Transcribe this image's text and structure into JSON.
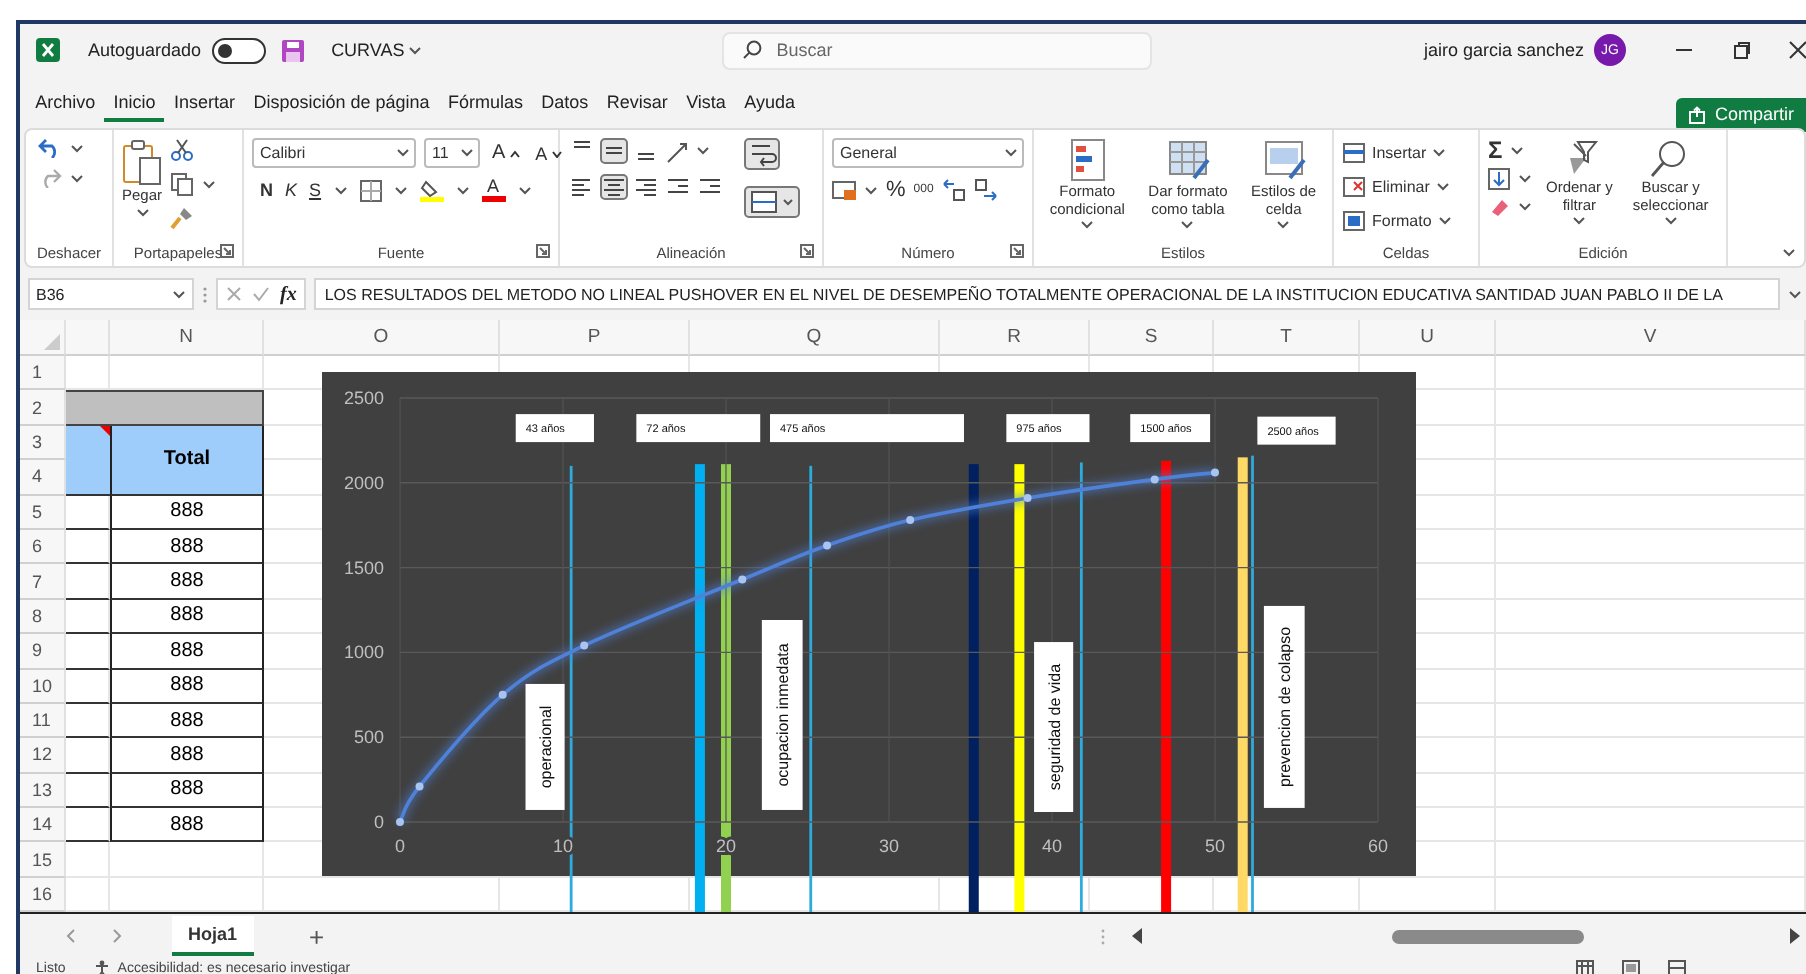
{
  "titlebar": {
    "autosave_label": "Autoguardado",
    "autosave_on": false,
    "file_name": "CURVAS",
    "search_placeholder": "Buscar",
    "user_name": "jairo garcia sanchez",
    "user_initials": "JG"
  },
  "menu": {
    "tabs": [
      {
        "label": "Archivo",
        "selected": false
      },
      {
        "label": "Inicio",
        "selected": true
      },
      {
        "label": "Insertar",
        "selected": false
      },
      {
        "label": "Disposición de página",
        "selected": false
      },
      {
        "label": "Fórmulas",
        "selected": false
      },
      {
        "label": "Datos",
        "selected": false
      },
      {
        "label": "Revisar",
        "selected": false
      },
      {
        "label": "Vista",
        "selected": false
      },
      {
        "label": "Ayuda",
        "selected": false
      }
    ],
    "share": "Compartir"
  },
  "ribbon": {
    "groups": [
      {
        "kind": "undo",
        "label": "Deshacer",
        "launcher": false
      },
      {
        "kind": "clipboard",
        "label": "Portapapeles",
        "paste": "Pegar",
        "launcher": true
      },
      {
        "kind": "font",
        "label": "Fuente",
        "font": "Calibri",
        "size": "11",
        "grow": "A",
        "shrink": "A",
        "bold": "N",
        "italic": "K",
        "underline": "S",
        "font_color": "A",
        "launcher": true
      },
      {
        "kind": "alignment",
        "label": "Alineación",
        "launcher": true,
        "vertical": [
          {
            "selected": false
          },
          {
            "selected": true
          },
          {
            "selected": false
          }
        ],
        "horizontal": [
          {
            "selected": false
          },
          {
            "selected": true
          },
          {
            "selected": false
          }
        ],
        "wrap_on": true,
        "merge_on": true
      },
      {
        "kind": "number",
        "label": "Número",
        "format": "General",
        "percent": "%",
        "thousands": "000",
        "launcher": true
      },
      {
        "kind": "styles",
        "label": "Estilos",
        "launcher": false,
        "buttons": [
          {
            "lines": [
              "Formato",
              "condicional"
            ]
          },
          {
            "lines": [
              "Dar formato",
              "como tabla"
            ]
          },
          {
            "lines": [
              "Estilos de",
              "celda"
            ]
          }
        ]
      },
      {
        "kind": "cells",
        "label": "Celdas",
        "launcher": false,
        "buttons": [
          "Insertar",
          "Eliminar",
          "Formato"
        ]
      },
      {
        "kind": "editing",
        "label": "Edición",
        "launcher": false,
        "sum": "Σ",
        "buttons": [
          {
            "lines": [
              "Ordenar y",
              "filtrar"
            ]
          },
          {
            "lines": [
              "Buscar y",
              "seleccionar"
            ]
          }
        ]
      }
    ]
  },
  "formula_bar": {
    "name_box": "B36",
    "fx": "fx",
    "formula": "LOS RESULTADOS DEL METODO NO LINEAL PUSHOVER EN EL NIVEL DE DESEMPEÑO TOTALMENTE OPERACIONAL DE LA INSTITUCION EDUCATIVA SANTIDAD JUAN PABLO II DE LA"
  },
  "sheet": {
    "columns": [
      "N",
      "O",
      "P",
      "Q",
      "R",
      "S",
      "T",
      "U",
      "V"
    ],
    "rows": [
      "1",
      "2",
      "3",
      "4",
      "5",
      "6",
      "7",
      "8",
      "9",
      "10",
      "11",
      "12",
      "13",
      "14",
      "15",
      "16"
    ],
    "table": {
      "header": "Total",
      "values": [
        "888",
        "888",
        "888",
        "888",
        "888",
        "888",
        "888",
        "888",
        "888",
        "888"
      ]
    },
    "chart": {
      "chart_data": {
        "type": "line",
        "x": [
          0,
          1.2,
          6.3,
          11.3,
          21,
          26.2,
          31.3,
          38.5,
          46.3,
          50
        ],
        "series": [
          {
            "color": "#4f81d9",
            "marker": "circle",
            "values": [
              0,
              210,
              750,
              1040,
              1430,
              1630,
              1780,
              1910,
              2020,
              2060
            ]
          }
        ],
        "xlim": [
          0,
          60
        ],
        "ylim": [
          0,
          2500
        ],
        "xticks": [
          0,
          10,
          20,
          30,
          40,
          50,
          60
        ],
        "yticks": [
          0,
          500,
          1000,
          1500,
          2000,
          2500
        ],
        "grid": true
      },
      "markers": [
        {
          "kind": "thin",
          "color": "#2eaadc"
        },
        {
          "kind": "thick",
          "color": "#00b0f0"
        },
        {
          "kind": "thick",
          "color": "#92d050"
        },
        {
          "kind": "thin",
          "color": "#2eaadc"
        },
        {
          "kind": "thick",
          "color": "#002060"
        },
        {
          "kind": "thick",
          "color": "#ffff00"
        },
        {
          "kind": "thin",
          "color": "#2eaadc"
        },
        {
          "kind": "thick",
          "color": "#ff0000"
        },
        {
          "kind": "thick",
          "color": "#ffd966"
        },
        {
          "kind": "thin",
          "color": "#2eaadc"
        }
      ],
      "labels": [
        "43 años",
        "72 años",
        "475 años",
        "975 años",
        "1500 años",
        "2500 años"
      ],
      "vertical_labels": [
        "operacional",
        "ocupacion inmedata",
        "seguridad de vida",
        "prevencion de colapso"
      ]
    }
  },
  "sheet_tabs": {
    "tabs": [
      {
        "label": "Hoja1",
        "selected": true
      }
    ],
    "add": "+"
  },
  "status_bar": {
    "status": "Listo",
    "accessibility": "Accesibilidad: es necesario investigar"
  }
}
